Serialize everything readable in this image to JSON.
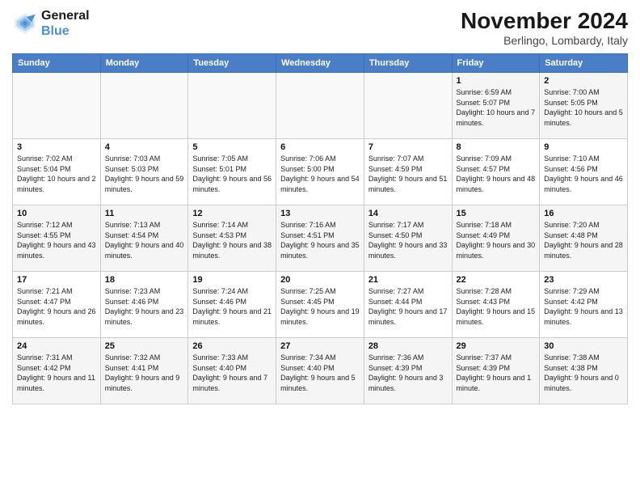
{
  "header": {
    "logo_line1": "General",
    "logo_line2": "Blue",
    "month_title": "November 2024",
    "location": "Berlingo, Lombardy, Italy"
  },
  "weekdays": [
    "Sunday",
    "Monday",
    "Tuesday",
    "Wednesday",
    "Thursday",
    "Friday",
    "Saturday"
  ],
  "weeks": [
    [
      {
        "day": "",
        "info": ""
      },
      {
        "day": "",
        "info": ""
      },
      {
        "day": "",
        "info": ""
      },
      {
        "day": "",
        "info": ""
      },
      {
        "day": "",
        "info": ""
      },
      {
        "day": "1",
        "info": "Sunrise: 6:59 AM\nSunset: 5:07 PM\nDaylight: 10 hours and 7 minutes."
      },
      {
        "day": "2",
        "info": "Sunrise: 7:00 AM\nSunset: 5:05 PM\nDaylight: 10 hours and 5 minutes."
      }
    ],
    [
      {
        "day": "3",
        "info": "Sunrise: 7:02 AM\nSunset: 5:04 PM\nDaylight: 10 hours and 2 minutes."
      },
      {
        "day": "4",
        "info": "Sunrise: 7:03 AM\nSunset: 5:03 PM\nDaylight: 9 hours and 59 minutes."
      },
      {
        "day": "5",
        "info": "Sunrise: 7:05 AM\nSunset: 5:01 PM\nDaylight: 9 hours and 56 minutes."
      },
      {
        "day": "6",
        "info": "Sunrise: 7:06 AM\nSunset: 5:00 PM\nDaylight: 9 hours and 54 minutes."
      },
      {
        "day": "7",
        "info": "Sunrise: 7:07 AM\nSunset: 4:59 PM\nDaylight: 9 hours and 51 minutes."
      },
      {
        "day": "8",
        "info": "Sunrise: 7:09 AM\nSunset: 4:57 PM\nDaylight: 9 hours and 48 minutes."
      },
      {
        "day": "9",
        "info": "Sunrise: 7:10 AM\nSunset: 4:56 PM\nDaylight: 9 hours and 46 minutes."
      }
    ],
    [
      {
        "day": "10",
        "info": "Sunrise: 7:12 AM\nSunset: 4:55 PM\nDaylight: 9 hours and 43 minutes."
      },
      {
        "day": "11",
        "info": "Sunrise: 7:13 AM\nSunset: 4:54 PM\nDaylight: 9 hours and 40 minutes."
      },
      {
        "day": "12",
        "info": "Sunrise: 7:14 AM\nSunset: 4:53 PM\nDaylight: 9 hours and 38 minutes."
      },
      {
        "day": "13",
        "info": "Sunrise: 7:16 AM\nSunset: 4:51 PM\nDaylight: 9 hours and 35 minutes."
      },
      {
        "day": "14",
        "info": "Sunrise: 7:17 AM\nSunset: 4:50 PM\nDaylight: 9 hours and 33 minutes."
      },
      {
        "day": "15",
        "info": "Sunrise: 7:18 AM\nSunset: 4:49 PM\nDaylight: 9 hours and 30 minutes."
      },
      {
        "day": "16",
        "info": "Sunrise: 7:20 AM\nSunset: 4:48 PM\nDaylight: 9 hours and 28 minutes."
      }
    ],
    [
      {
        "day": "17",
        "info": "Sunrise: 7:21 AM\nSunset: 4:47 PM\nDaylight: 9 hours and 26 minutes."
      },
      {
        "day": "18",
        "info": "Sunrise: 7:23 AM\nSunset: 4:46 PM\nDaylight: 9 hours and 23 minutes."
      },
      {
        "day": "19",
        "info": "Sunrise: 7:24 AM\nSunset: 4:46 PM\nDaylight: 9 hours and 21 minutes."
      },
      {
        "day": "20",
        "info": "Sunrise: 7:25 AM\nSunset: 4:45 PM\nDaylight: 9 hours and 19 minutes."
      },
      {
        "day": "21",
        "info": "Sunrise: 7:27 AM\nSunset: 4:44 PM\nDaylight: 9 hours and 17 minutes."
      },
      {
        "day": "22",
        "info": "Sunrise: 7:28 AM\nSunset: 4:43 PM\nDaylight: 9 hours and 15 minutes."
      },
      {
        "day": "23",
        "info": "Sunrise: 7:29 AM\nSunset: 4:42 PM\nDaylight: 9 hours and 13 minutes."
      }
    ],
    [
      {
        "day": "24",
        "info": "Sunrise: 7:31 AM\nSunset: 4:42 PM\nDaylight: 9 hours and 11 minutes."
      },
      {
        "day": "25",
        "info": "Sunrise: 7:32 AM\nSunset: 4:41 PM\nDaylight: 9 hours and 9 minutes."
      },
      {
        "day": "26",
        "info": "Sunrise: 7:33 AM\nSunset: 4:40 PM\nDaylight: 9 hours and 7 minutes."
      },
      {
        "day": "27",
        "info": "Sunrise: 7:34 AM\nSunset: 4:40 PM\nDaylight: 9 hours and 5 minutes."
      },
      {
        "day": "28",
        "info": "Sunrise: 7:36 AM\nSunset: 4:39 PM\nDaylight: 9 hours and 3 minutes."
      },
      {
        "day": "29",
        "info": "Sunrise: 7:37 AM\nSunset: 4:39 PM\nDaylight: 9 hours and 1 minute."
      },
      {
        "day": "30",
        "info": "Sunrise: 7:38 AM\nSunset: 4:38 PM\nDaylight: 9 hours and 0 minutes."
      }
    ]
  ]
}
